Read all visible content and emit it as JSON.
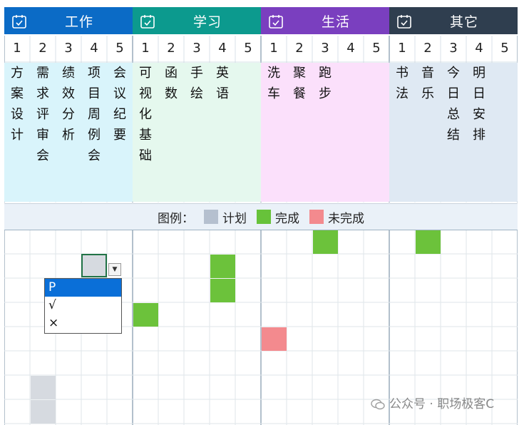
{
  "categories": [
    {
      "title": "工作",
      "color": "#0b6bc6",
      "bg": "#d9f4fb",
      "tasks": [
        "方\n案\n设\n计",
        "需\n求\n评\n审\n会",
        "绩\n效\n分\n析",
        "项\n目\n周\n例\n会",
        "会\n议\n纪\n要"
      ]
    },
    {
      "title": "学习",
      "color": "#0c9a8e",
      "bg": "#e5f8ee",
      "tasks": [
        "可\n视\n化\n基\n础",
        "函\n数",
        "手\n绘",
        "英\n语",
        ""
      ]
    },
    {
      "title": "生活",
      "color": "#7a3fbf",
      "bg": "#fbe0fb",
      "tasks": [
        "洗\n车",
        "聚\n餐",
        "跑\n步",
        "",
        ""
      ]
    },
    {
      "title": "其它",
      "color": "#2f3e4f",
      "bg": "#dfe9f3",
      "tasks": [
        "书\n法",
        "音\n乐",
        "今\n日\n总\n结",
        "明\n日\n安\n排",
        ""
      ]
    }
  ],
  "numbers": [
    "1",
    "2",
    "3",
    "4",
    "5"
  ],
  "legend": {
    "label": "图例：",
    "items": [
      {
        "label": "计划",
        "color": "#b5c0cf"
      },
      {
        "label": "完成",
        "color": "#67c23a"
      },
      {
        "label": "未完成",
        "color": "#f38a8e"
      }
    ]
  },
  "dropdown": {
    "options": [
      "P",
      "√",
      "×"
    ],
    "selected": "P"
  },
  "watermark": "公众号 · 职场极客C",
  "colors": {
    "plan": "#d6dae0",
    "done": "#6cc23b",
    "undone": "#f38a8e",
    "divider": "#8097ab",
    "grid": "#dfe5ea"
  }
}
